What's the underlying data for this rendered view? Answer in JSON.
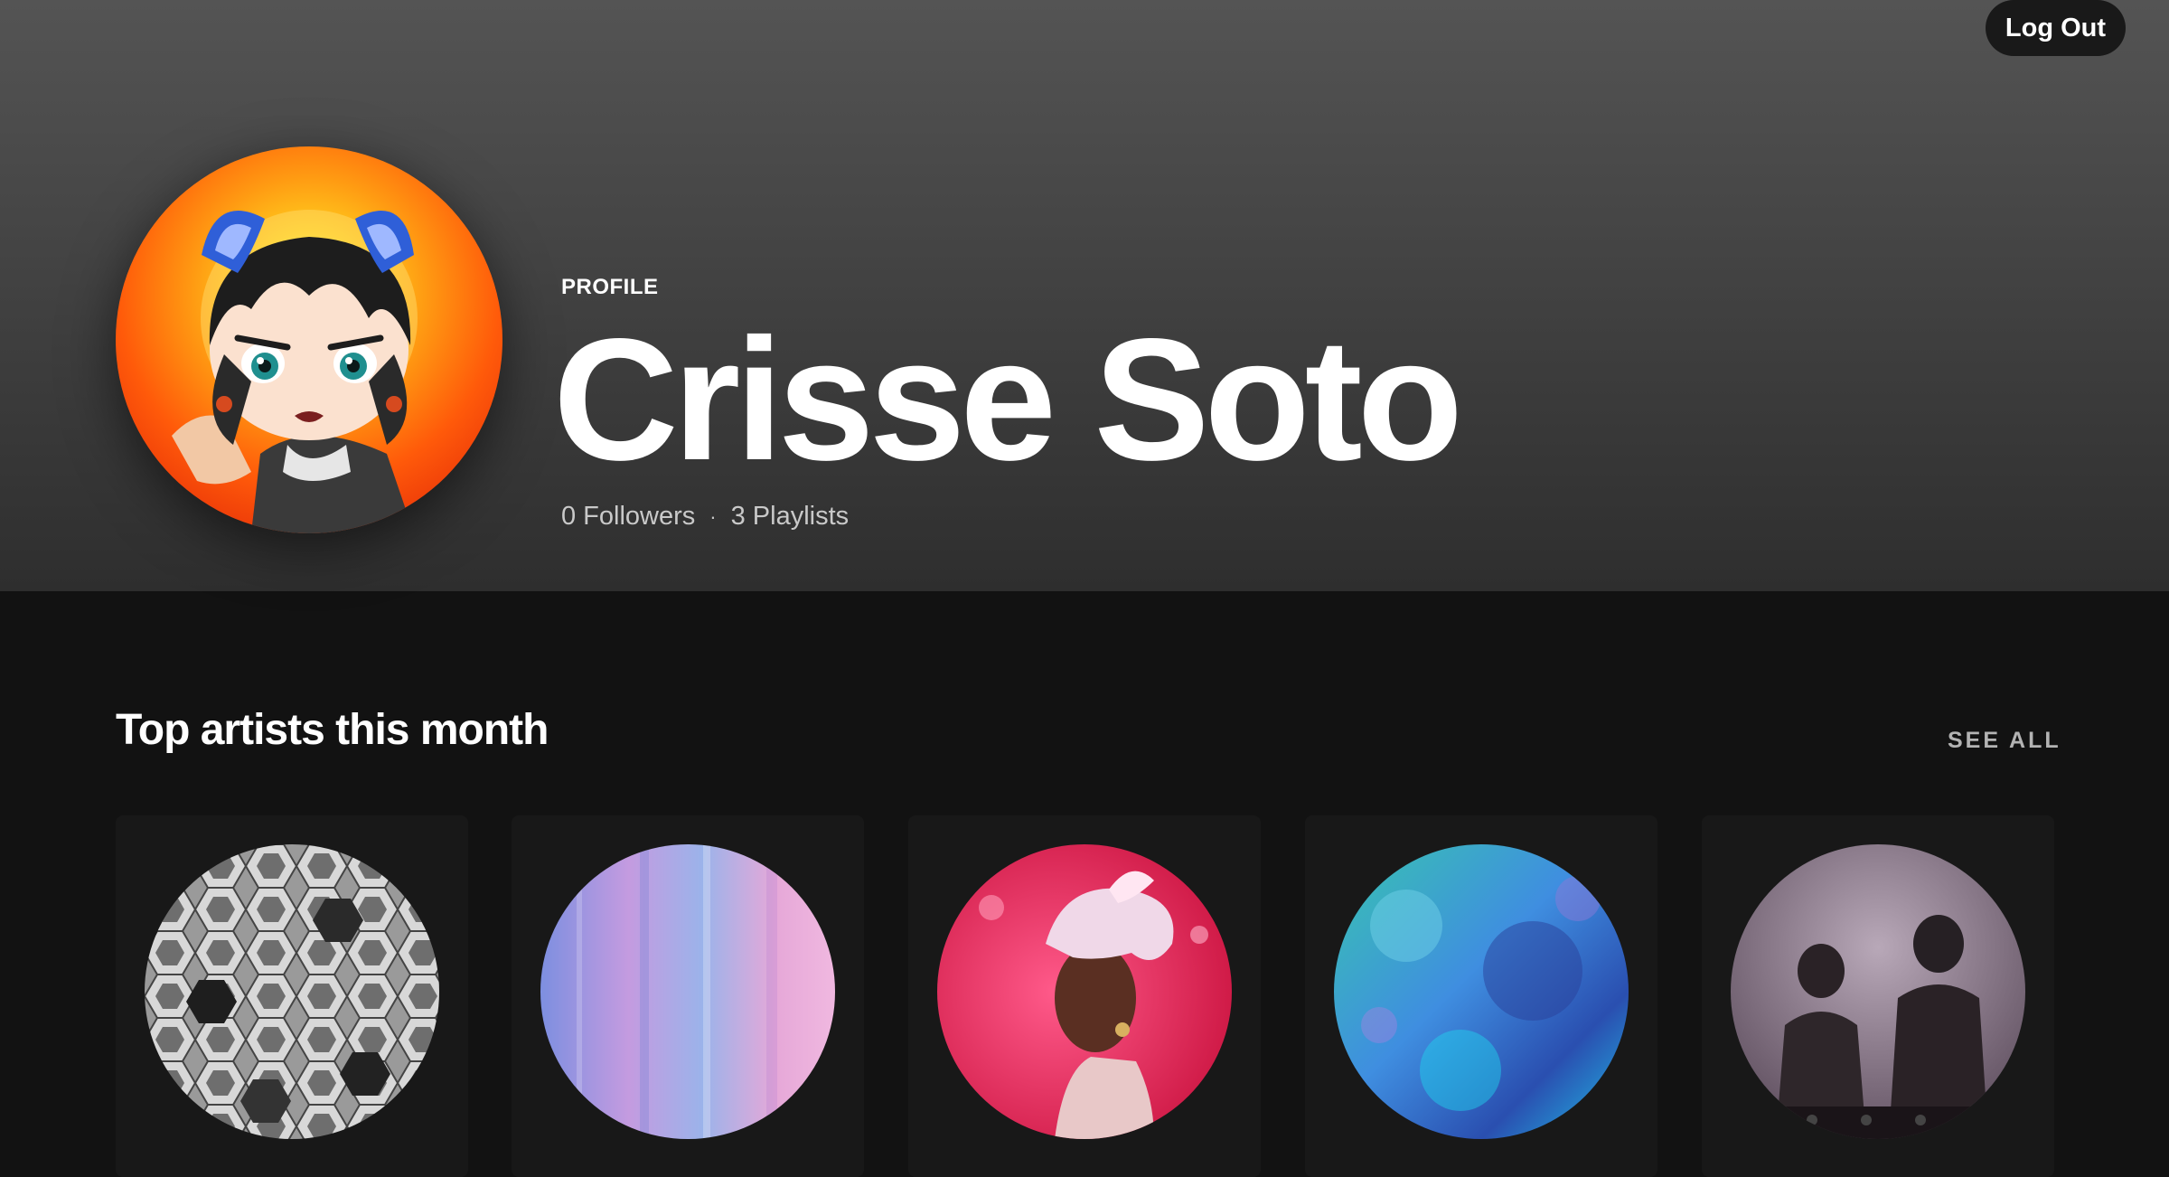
{
  "header": {
    "logout_label": "Log Out",
    "profile_label": "PROFILE",
    "name": "Crisse Soto",
    "followers": "0 Followers",
    "separator": "·",
    "playlists": "3 Playlists"
  },
  "top_artists": {
    "title": "Top artists this month",
    "see_all_label": "SEE ALL",
    "artists": [
      {
        "image": "hexagon-pattern-artwork"
      },
      {
        "image": "pastel-gradient-artwork"
      },
      {
        "image": "woman-with-headscarf-photo"
      },
      {
        "image": "blue-textured-artwork"
      },
      {
        "image": "two-djs-in-smoke-photo"
      }
    ]
  },
  "colors": {
    "header_top": "#545454",
    "header_bottom": "#2e2e2e",
    "page_background": "#121212",
    "card_background": "#181818",
    "muted_text": "#b3b3b3"
  }
}
